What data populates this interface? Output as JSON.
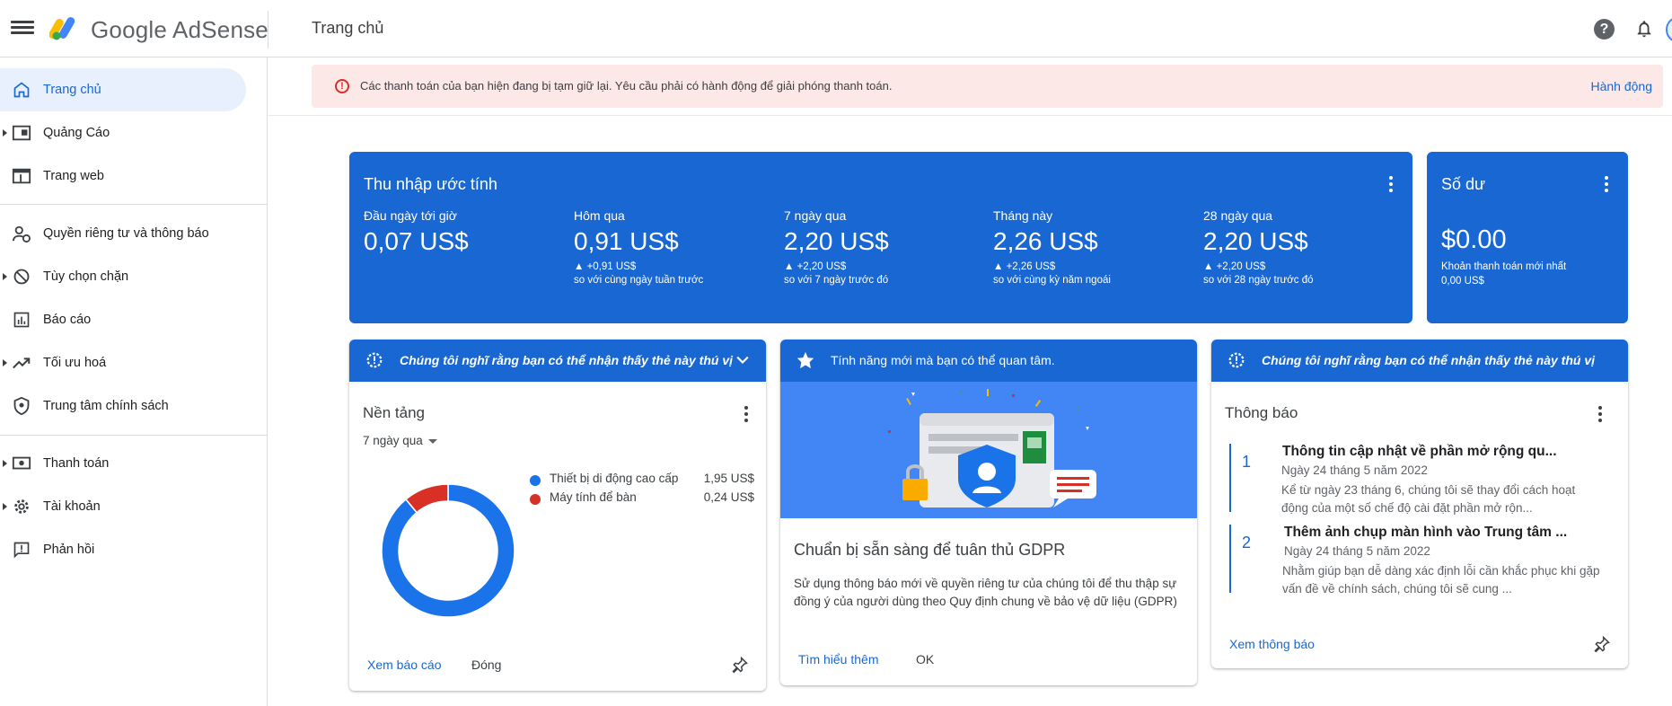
{
  "app": {
    "brand_prefix": "Google",
    "brand_name": "AdSense",
    "page_title": "Trang chủ"
  },
  "header": {
    "help_icon": "help-circle-icon",
    "help_glyph": "?",
    "bell_icon": "notifications-bell-icon"
  },
  "sidebar": {
    "items": [
      {
        "label": "Trang chủ",
        "icon": "home-icon",
        "active": true
      },
      {
        "label": "Quảng Cáo",
        "icon": "ads-icon",
        "expandable": true
      },
      {
        "label": "Trang web",
        "icon": "sites-icon"
      },
      {
        "label": "Quyền riêng tư và thông báo",
        "icon": "privacy-messaging-icon"
      },
      {
        "label": "Tùy chọn chặn",
        "icon": "block-icon",
        "expandable": true
      },
      {
        "label": "Báo cáo",
        "icon": "reports-icon"
      },
      {
        "label": "Tối ưu hoá",
        "icon": "optimization-trend-icon",
        "expandable": true
      },
      {
        "label": "Trung tâm chính sách",
        "icon": "policy-shield-icon"
      },
      {
        "label": "Thanh toán",
        "icon": "payments-icon",
        "expandable": true
      },
      {
        "label": "Tài khoản",
        "icon": "account-gear-icon",
        "expandable": true
      },
      {
        "label": "Phản hồi",
        "icon": "feedback-icon"
      }
    ]
  },
  "alert": {
    "icon": "error-icon",
    "glyph": "!",
    "text": "Các thanh toán của bạn hiện đang bị tạm giữ lại. Yêu cầu phải có hành động để giải phóng thanh toán.",
    "action": "Hành động",
    "color": "#d93025"
  },
  "earnings": {
    "title": "Thu nhập ước tính",
    "metrics": [
      {
        "label": "Đầu ngày tới giờ",
        "value": "0,07 US$",
        "delta": "",
        "compare": ""
      },
      {
        "label": "Hôm qua",
        "value": "0,91 US$",
        "delta": "▲ +0,91 US$",
        "compare": "so với cùng ngày tuần trước"
      },
      {
        "label": "7 ngày qua",
        "value": "2,20 US$",
        "delta": "▲ +2,20 US$",
        "compare": "so với 7 ngày trước đó"
      },
      {
        "label": "Tháng này",
        "value": "2,26 US$",
        "delta": "▲ +2,26 US$",
        "compare": "so với cùng kỳ năm ngoái"
      },
      {
        "label": "28 ngày qua",
        "value": "2,20 US$",
        "delta": "▲ +2,20 US$",
        "compare": "so với 28 ngày trước đó"
      }
    ]
  },
  "balance": {
    "title": "Số dư",
    "value": "$0.00",
    "sub_label": "Khoản thanh toán mới nhất",
    "sub_value": "0,00 US$"
  },
  "platform_card": {
    "header": "Chúng tôi nghĩ rằng bạn có thể nhận thấy thẻ này thú vị",
    "title": "Nền tảng",
    "range": "7 ngày qua",
    "legend": [
      {
        "label": "Thiết bị di động cao cấp",
        "value": "1,95 US$",
        "color": "#1a73e8"
      },
      {
        "label": "Máy tính để bàn",
        "value": "0,24 US$",
        "color": "#d93025"
      }
    ],
    "link": "Xem báo cáo",
    "dismiss": "Đóng"
  },
  "chart_data": {
    "type": "pie",
    "categories": [
      "Thiết bị di động cao cấp",
      "Máy tính để bàn"
    ],
    "values": [
      1.95,
      0.24
    ],
    "colors": [
      "#1a73e8",
      "#d93025"
    ],
    "style": "donut"
  },
  "gdpr_card": {
    "header": "Tính năng mới mà bạn có thể quan tâm.",
    "title": "Chuẩn bị sẵn sàng để tuân thủ GDPR",
    "body": "Sử dụng thông báo mới về quyền riêng tư của chúng tôi để thu thập sự đồng ý của người dùng theo Quy định chung về bảo vệ dữ liệu (GDPR)",
    "link": "Tìm hiểu thêm",
    "ok": "OK"
  },
  "notifications_card": {
    "header": "Chúng tôi nghĩ rằng bạn có thể nhận thấy thẻ này thú vị",
    "title": "Thông báo",
    "items": [
      {
        "num": "1",
        "title": "Thông tin cập nhật về phần mở rộng qu...",
        "date": "Ngày 24 tháng 5 năm 2022",
        "body": "Kể từ ngày 23 tháng 6, chúng tôi sẽ thay đổi cách hoạt động của một số chế độ cài đặt phần mở rộn..."
      },
      {
        "num": "2",
        "title": "Thêm ảnh chụp màn hình vào Trung tâm ...",
        "date": "Ngày 24 tháng 5 năm 2022",
        "body": "Nhằm giúp bạn dễ dàng xác định lỗi cần khắc phục khi gặp vấn đề về chính sách, chúng tôi sẽ cung ..."
      }
    ],
    "link": "Xem thông báo"
  }
}
